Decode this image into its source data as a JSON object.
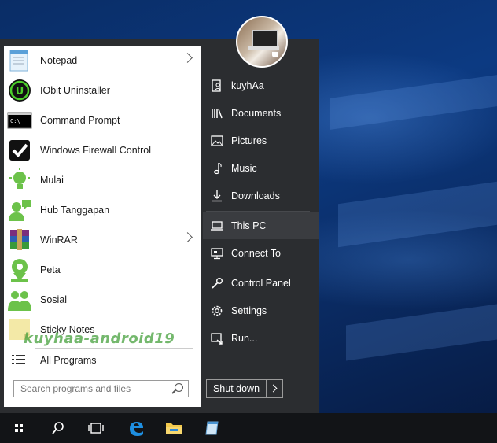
{
  "programs": [
    {
      "label": "Notepad",
      "icon": "notepad-icon",
      "submenu": true
    },
    {
      "label": "IObit Uninstaller",
      "icon": "iobit-uninstaller-icon",
      "submenu": false
    },
    {
      "label": "Command Prompt",
      "icon": "command-prompt-icon",
      "submenu": false
    },
    {
      "label": "Windows Firewall Control",
      "icon": "firewall-control-icon",
      "submenu": false
    },
    {
      "label": "Mulai",
      "icon": "lightbulb-icon",
      "submenu": false
    },
    {
      "label": "Hub Tanggapan",
      "icon": "feedback-hub-icon",
      "submenu": false
    },
    {
      "label": "WinRAR",
      "icon": "winrar-icon",
      "submenu": true
    },
    {
      "label": "Peta",
      "icon": "maps-icon",
      "submenu": false
    },
    {
      "label": "Sosial",
      "icon": "people-icon",
      "submenu": false
    },
    {
      "label": "Sticky Notes",
      "icon": "sticky-notes-icon",
      "submenu": false
    }
  ],
  "all_programs": "All Programs",
  "search": {
    "placeholder": "Search programs and files"
  },
  "right": [
    {
      "label": "kuyhAa",
      "icon": "user-folder-icon"
    },
    {
      "label": "Documents",
      "icon": "documents-icon"
    },
    {
      "label": "Pictures",
      "icon": "pictures-icon"
    },
    {
      "label": "Music",
      "icon": "music-icon"
    },
    {
      "label": "Downloads",
      "icon": "downloads-icon"
    },
    {
      "label": "This PC",
      "icon": "this-pc-icon"
    },
    {
      "label": "Connect To",
      "icon": "connect-to-icon"
    },
    {
      "label": "Control Panel",
      "icon": "control-panel-icon"
    },
    {
      "label": "Settings",
      "icon": "settings-gear-icon"
    },
    {
      "label": "Run...",
      "icon": "run-icon"
    }
  ],
  "shutdown": {
    "label": "Shut down"
  },
  "watermark": "kuyhaa-android19",
  "taskbar": [
    "start-icon",
    "search-icon",
    "task-view-icon",
    "edge-icon",
    "file-explorer-icon",
    "notepad-icon"
  ],
  "colors": {
    "accent": "#0078d7",
    "menu_bg": "#2b2d30",
    "green": "#3cb043"
  }
}
